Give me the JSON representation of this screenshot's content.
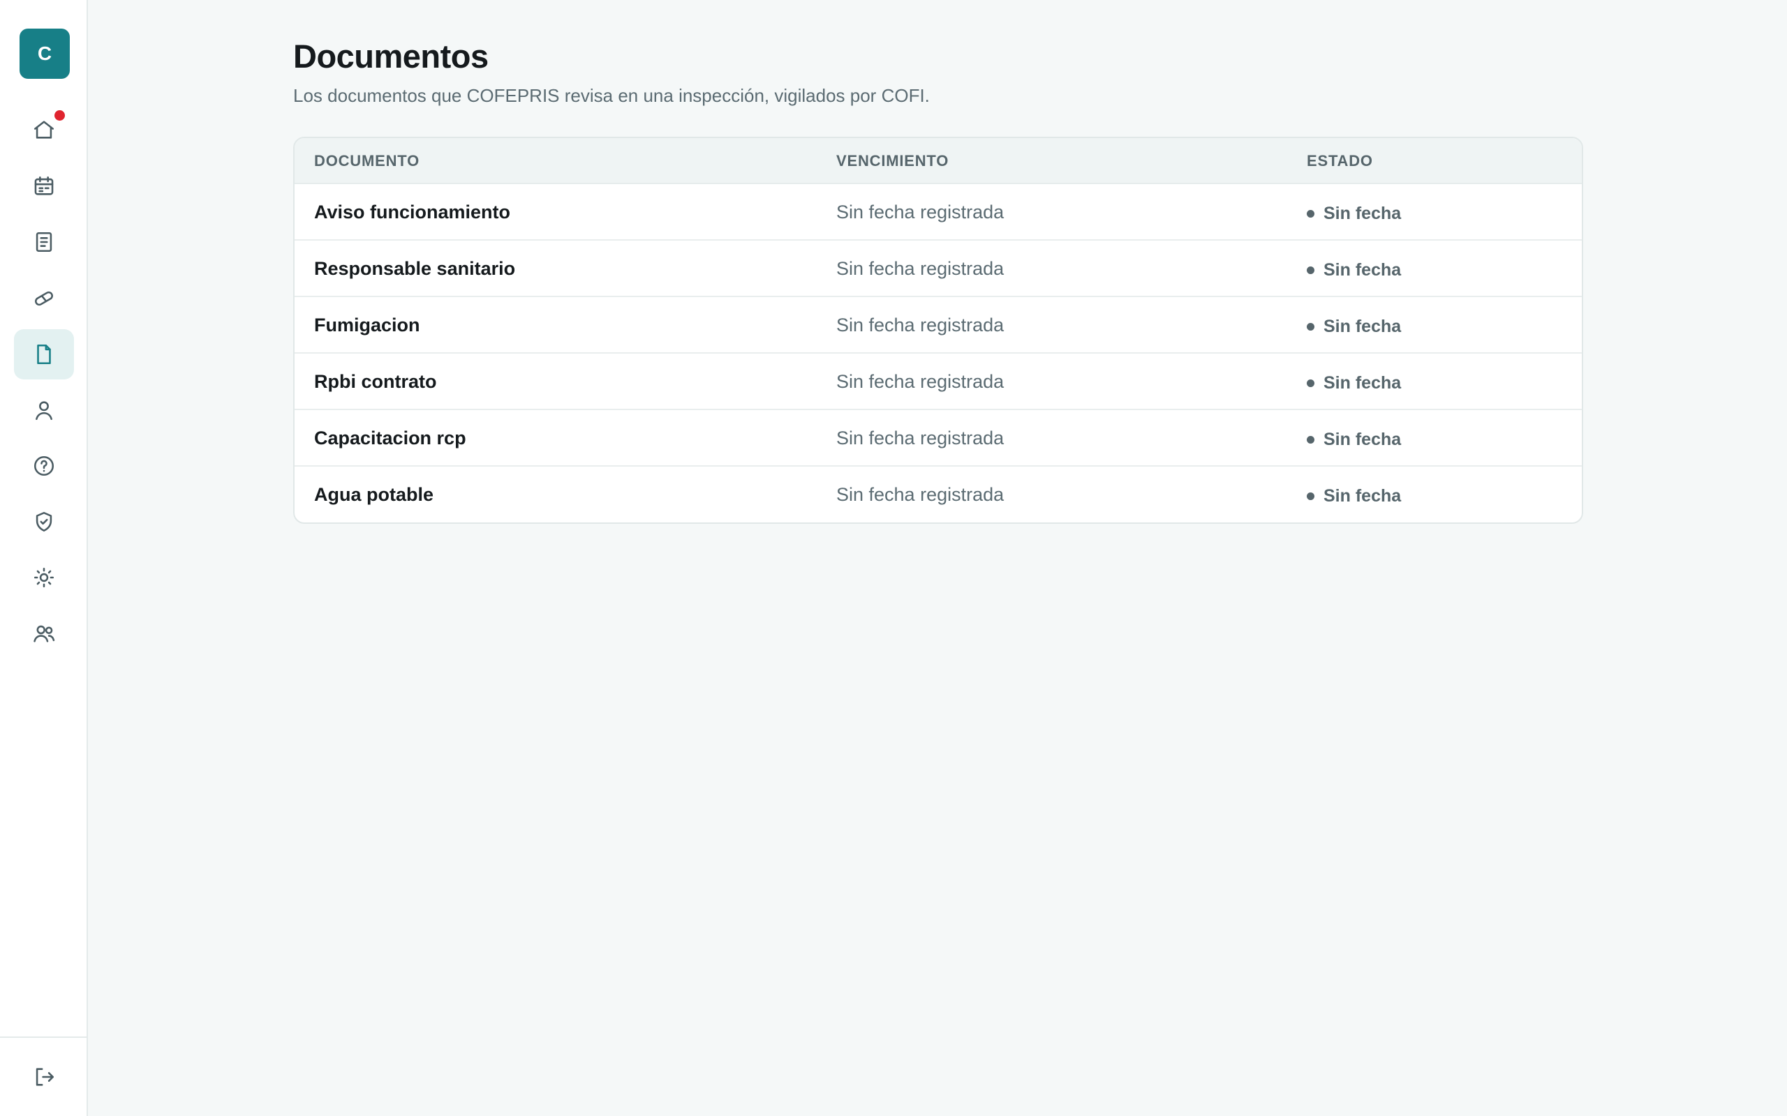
{
  "sidebar": {
    "avatar_initial": "C",
    "notification_color": "#e0242f",
    "accent_color": "#177f87",
    "items": [
      {
        "name": "home",
        "icon": "home-icon",
        "has_badge": true
      },
      {
        "name": "calendar",
        "icon": "calendar-icon"
      },
      {
        "name": "reports",
        "icon": "file-text-icon"
      },
      {
        "name": "medications",
        "icon": "pill-icon"
      },
      {
        "name": "documents",
        "icon": "file-icon",
        "active": true
      },
      {
        "name": "profile",
        "icon": "user-icon"
      },
      {
        "name": "help",
        "icon": "help-circle-icon"
      },
      {
        "name": "compliance",
        "icon": "shield-check-icon"
      },
      {
        "name": "settings",
        "icon": "sun-icon"
      },
      {
        "name": "team",
        "icon": "users-icon"
      }
    ],
    "logout_icon": "logout-icon"
  },
  "header": {
    "title": "Documentos",
    "subtitle": "Los documentos que COFEPRIS revisa en una inspección, vigilados por COFI."
  },
  "table": {
    "columns": [
      "DOCUMENTO",
      "VENCIMIENTO",
      "ESTADO"
    ],
    "rows": [
      {
        "document": "Aviso funcionamiento",
        "expiry": "Sin fecha registrada",
        "status": "Sin fecha"
      },
      {
        "document": "Responsable sanitario",
        "expiry": "Sin fecha registrada",
        "status": "Sin fecha"
      },
      {
        "document": "Fumigacion",
        "expiry": "Sin fecha registrada",
        "status": "Sin fecha"
      },
      {
        "document": "Rpbi contrato",
        "expiry": "Sin fecha registrada",
        "status": "Sin fecha"
      },
      {
        "document": "Capacitacion rcp",
        "expiry": "Sin fecha registrada",
        "status": "Sin fecha"
      },
      {
        "document": "Agua potable",
        "expiry": "Sin fecha registrada",
        "status": "Sin fecha"
      }
    ]
  }
}
